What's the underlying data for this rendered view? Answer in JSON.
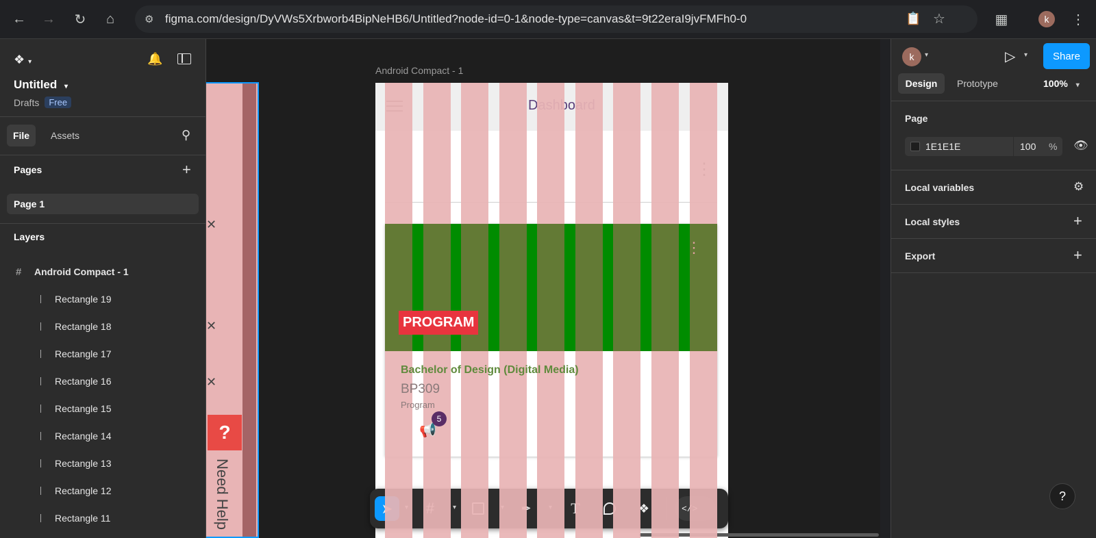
{
  "browser": {
    "url": "figma.com/design/DyVWs5Xrbworb4BipNeHB6/Untitled?node-id=0-1&node-type=canvas&t=9t22eraI9jvFMFh0-0",
    "profile_initial": "k"
  },
  "left_panel": {
    "file_name": "Untitled",
    "location": "Drafts",
    "plan_badge": "Free",
    "tabs": [
      "File",
      "Assets"
    ],
    "pages_title": "Pages",
    "pages": [
      "Page 1"
    ],
    "layers_title": "Layers",
    "frame_name": "Android Compact - 1",
    "layers": [
      "Rectangle 19",
      "Rectangle 18",
      "Rectangle 17",
      "Rectangle 16",
      "Rectangle 15",
      "Rectangle 14",
      "Rectangle 13",
      "Rectangle 12",
      "Rectangle 11"
    ]
  },
  "canvas": {
    "frame_label": "Android Compact - 1",
    "app_title": "Dashboard",
    "tag": "PROGRAM",
    "program_name": "Bachelor of Design (Digital Media)",
    "program_code": "BP309",
    "program_type": "Program",
    "notification_count": "5",
    "side_help_text": "Need Help",
    "side_help_icon": "?"
  },
  "right_panel": {
    "profile_initial": "k",
    "share_label": "Share",
    "tabs": [
      "Design",
      "Prototype"
    ],
    "zoom": "100%",
    "page_title": "Page",
    "page_color": "1E1E1E",
    "page_opacity": "100",
    "percent": "%",
    "sections": [
      "Local variables",
      "Local styles",
      "Export"
    ]
  },
  "help_label": "?",
  "colors": {
    "accent": "#0d99ff",
    "canvas_bg": "#1e1e1e",
    "panel_bg": "#2c2c2c",
    "grid_pink": "#e8b4b5",
    "banner_green": "#008c00",
    "banner_olive": "#637a35",
    "tag_red": "#e8343e",
    "program_green": "#5f8a3c",
    "badge_purple": "#5a2d66"
  }
}
